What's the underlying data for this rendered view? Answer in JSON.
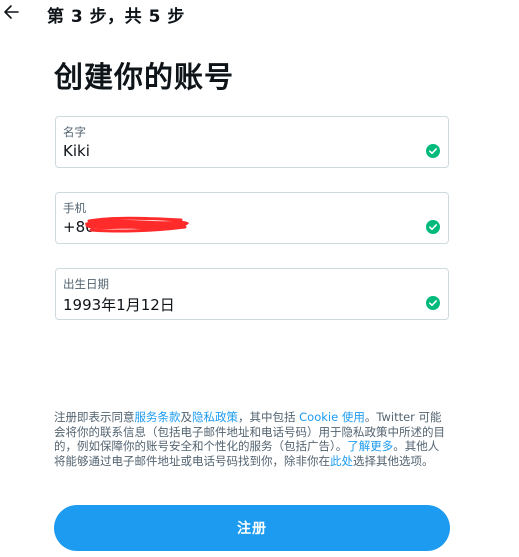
{
  "header": {
    "step_label": "第 3 步，共 5 步"
  },
  "title": "创建你的账号",
  "fields": {
    "name": {
      "label": "名字",
      "value": "Kiki"
    },
    "phone": {
      "label": "手机",
      "value": "+86"
    },
    "dob": {
      "label": "出生日期",
      "value": "1993年1月12日"
    }
  },
  "terms": {
    "t1": "注册即表示同意",
    "link_tos": "服务条款",
    "t2": "及",
    "link_privacy": "隐私政策",
    "t3": "，其中包括 ",
    "link_cookie": "Cookie 使用",
    "t4": "。Twitter 可能会将你的联系信息（包括电子邮件地址和电话号码）用于隐私政策中所述的目的，例如保障你的账号安全和个性化的服务（包括广告）。",
    "link_learn": "了解更多",
    "t5": "。其他人将能够通过电子邮件地址或电话号码找到你，除非你在",
    "link_here": "此处",
    "t6": "选择其他选项。"
  },
  "signup_label": "注册",
  "colors": {
    "accent": "#1d9bf0",
    "valid": "#00ba7c",
    "redaction": "#ff2a2a"
  }
}
